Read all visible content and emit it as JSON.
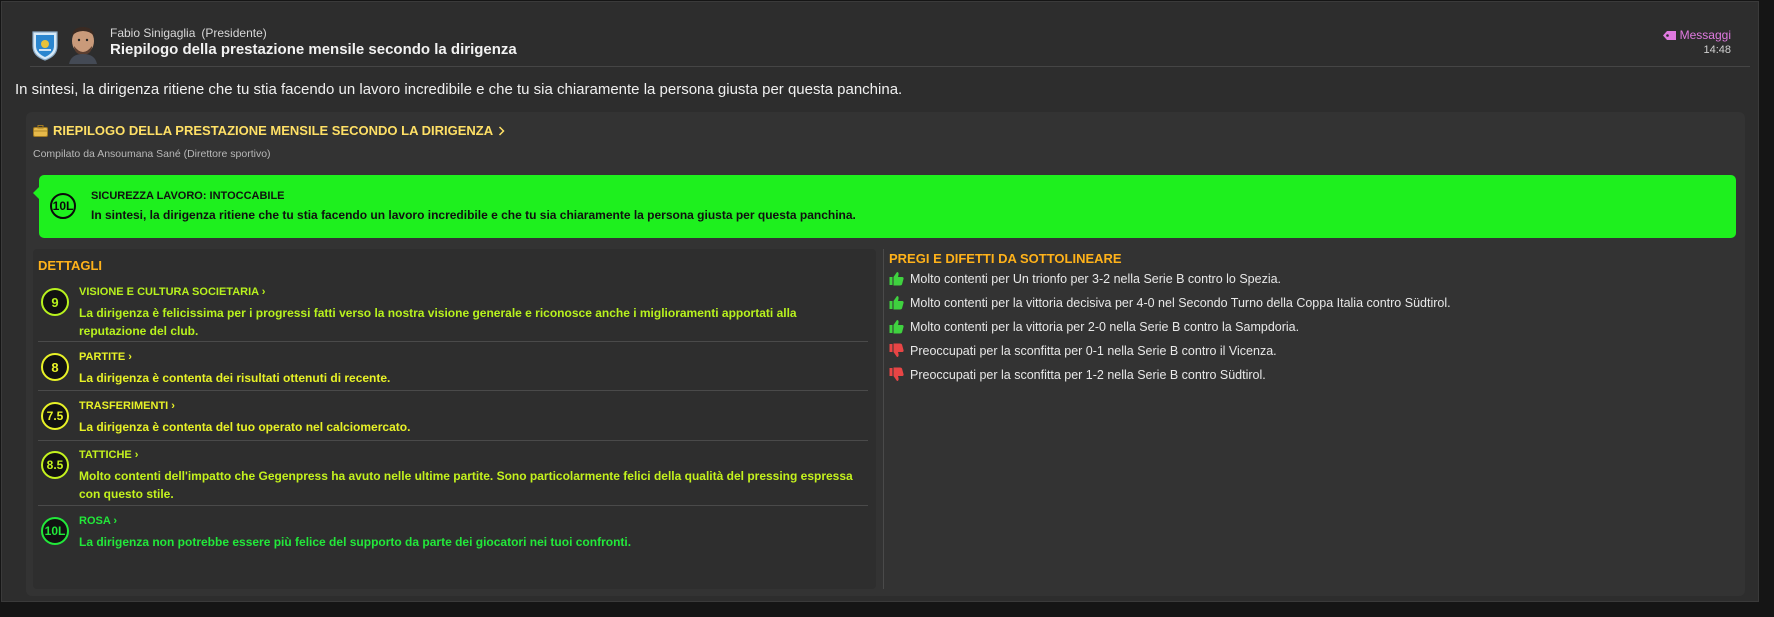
{
  "header": {
    "sender_name": "Fabio Sinigaglia",
    "sender_role": "(Presidente)",
    "subject": "Riepilogo della prestazione mensile secondo la dirigenza",
    "messages_label": "Messaggi",
    "time": "14:48"
  },
  "summary_text": "In sintesi, la dirigenza ritiene che tu stia facendo un lavoro incredibile e che tu sia chiaramente la persona giusta per questa panchina.",
  "report": {
    "title": "RIEPILOGO DELLA PRESTAZIONE MENSILE SECONDO LA DIRIGENZA",
    "compiled_by": "Compilato da Ansoumana Sané (Direttore sportivo)",
    "security": {
      "badge": "10L",
      "title": "SICUREZZA LAVORO: INTOCCABILE",
      "text": "In sintesi, la dirigenza ritiene che tu stia facendo un lavoro incredibile e che tu sia chiaramente la persona giusta per questa panchina.",
      "color": "#1ef01e"
    },
    "details_title": "DETTAGLI",
    "details": [
      {
        "score": "9",
        "title": "VISIONE E CULTURA SOCIETARIA",
        "text": "La dirigenza è felicissima per i progressi fatti verso la nostra visione generale e riconosce anche i miglioramenti apportati alla reputazione del club.",
        "color": "#b8f21e"
      },
      {
        "score": "8",
        "title": "PARTITE",
        "text": "La dirigenza è contenta dei risultati ottenuti di recente.",
        "color": "#e8f227"
      },
      {
        "score": "7.5",
        "title": "TRASFERIMENTI",
        "text": "La dirigenza è contenta del tuo operato nel calciomercato.",
        "color": "#e8f227"
      },
      {
        "score": "8.5",
        "title": "TATTICHE",
        "text": "Molto contenti dell'impatto che Gegenpress ha avuto nelle ultime partite. Sono particolarmente felici della qualità del pressing espressa con questo stile.",
        "color": "#c4f21e"
      },
      {
        "score": "10L",
        "title": "ROSA",
        "text": "La dirigenza non potrebbe essere più felice del supporto da parte dei giocatori nei tuoi confronti.",
        "color": "#22e83a"
      }
    ],
    "pros_cons_title": "PREGI E DIFETTI DA SOTTOLINEARE",
    "pros_cons": [
      {
        "type": "pro",
        "text": "Molto contenti per Un trionfo per 3-2 nella Serie B contro lo Spezia.",
        "icon": "thumbs-up-icon"
      },
      {
        "type": "pro",
        "text": "Molto contenti per la vittoria decisiva per 4-0 nel Secondo Turno della Coppa Italia contro Südtirol.",
        "icon": "thumbs-up-icon"
      },
      {
        "type": "pro",
        "text": "Molto contenti per la vittoria per 2-0 nella Serie B contro la Sampdoria.",
        "icon": "thumbs-up-icon"
      },
      {
        "type": "con",
        "text": "Preoccupati per la sconfitta per 0-1 nella Serie B contro il Vicenza.",
        "icon": "thumbs-down-icon"
      },
      {
        "type": "con",
        "text": "Preoccupati per la sconfitta per 1-2 nella Serie B contro Südtirol.",
        "icon": "thumbs-down-icon"
      }
    ],
    "pro_color": "#3fd23f",
    "con_color": "#e84545"
  }
}
